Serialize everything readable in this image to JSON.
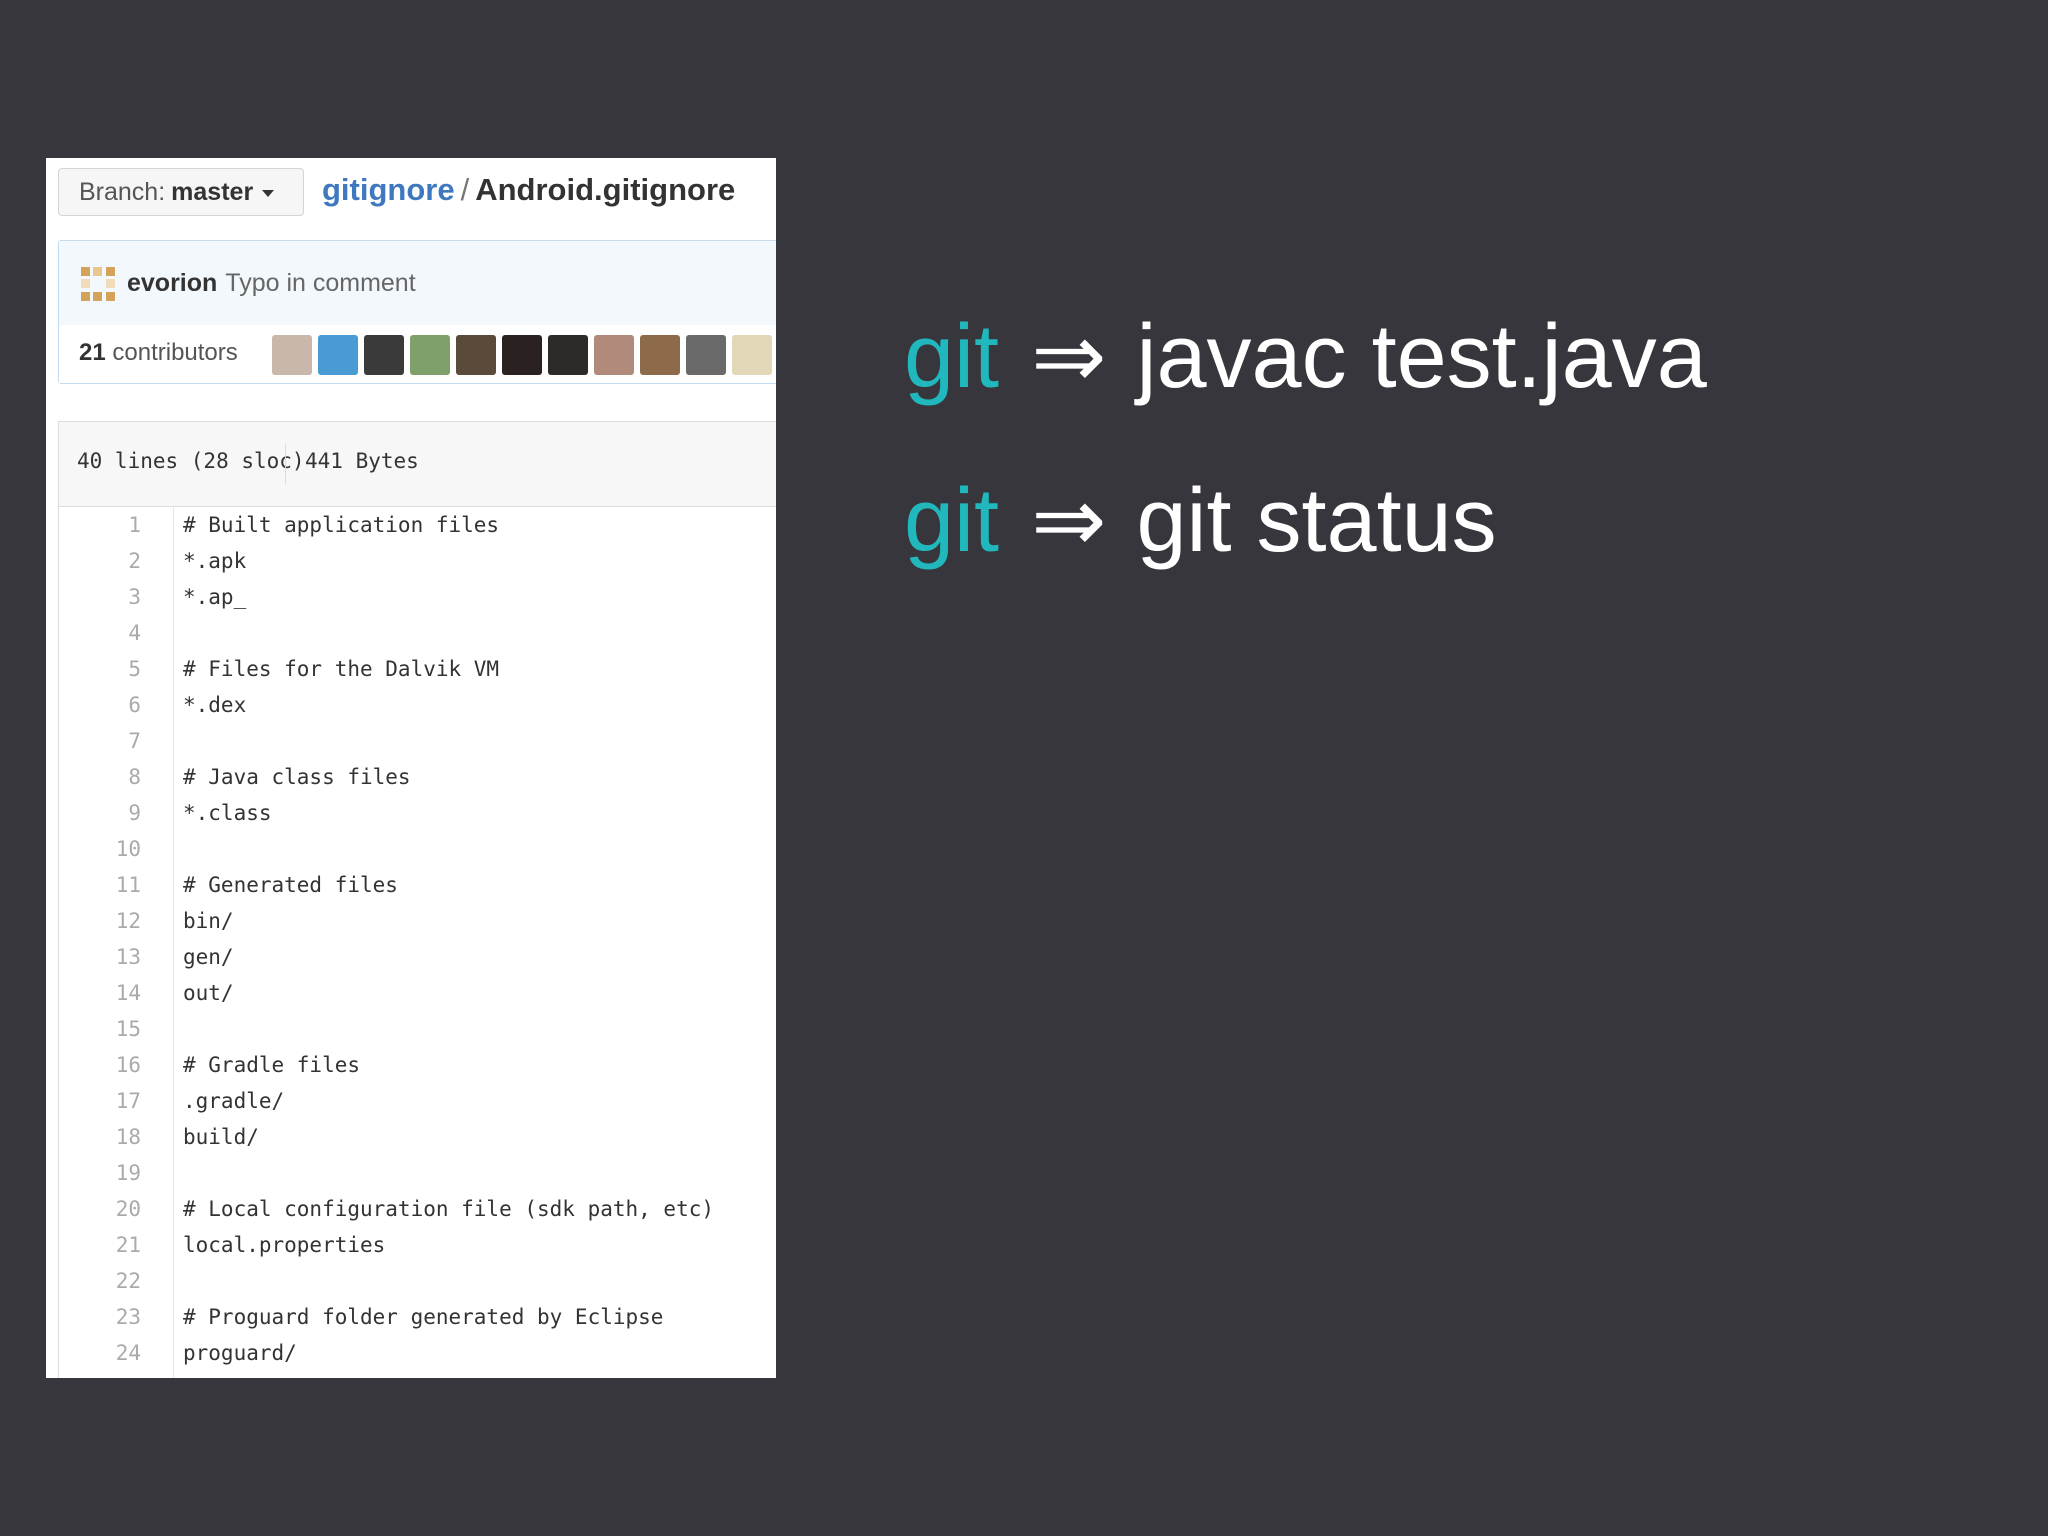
{
  "file_view": {
    "branch": {
      "prefix": "Branch:",
      "name": "master"
    },
    "breadcrumb": {
      "repo": "gitignore",
      "separator": "/",
      "file": "Android.gitignore"
    },
    "commit": {
      "author": "evorion",
      "message": "Typo in comment"
    },
    "contributors": {
      "count": "21",
      "label": "contributors"
    },
    "avatar_colors": [
      "#c9b7ab",
      "#4a9ad4",
      "#3a3a3a",
      "#7fa06a",
      "#5a4a3a",
      "#2a2220",
      "#2e2a28",
      "#b08a7a",
      "#8c6a4a",
      "#6a6a6a",
      "#e2d8b8"
    ],
    "file_info": {
      "lines": "40 lines (28 sloc)",
      "size": "441 Bytes"
    },
    "code_lines": [
      {
        "n": "1",
        "text": "# Built application files"
      },
      {
        "n": "2",
        "text": "*.apk"
      },
      {
        "n": "3",
        "text": "*.ap_"
      },
      {
        "n": "4",
        "text": ""
      },
      {
        "n": "5",
        "text": "# Files for the Dalvik VM"
      },
      {
        "n": "6",
        "text": "*.dex"
      },
      {
        "n": "7",
        "text": ""
      },
      {
        "n": "8",
        "text": "# Java class files"
      },
      {
        "n": "9",
        "text": "*.class"
      },
      {
        "n": "10",
        "text": ""
      },
      {
        "n": "11",
        "text": "# Generated files"
      },
      {
        "n": "12",
        "text": "bin/"
      },
      {
        "n": "13",
        "text": "gen/"
      },
      {
        "n": "14",
        "text": "out/"
      },
      {
        "n": "15",
        "text": ""
      },
      {
        "n": "16",
        "text": "# Gradle files"
      },
      {
        "n": "17",
        "text": ".gradle/"
      },
      {
        "n": "18",
        "text": "build/"
      },
      {
        "n": "19",
        "text": ""
      },
      {
        "n": "20",
        "text": "# Local configuration file (sdk path, etc)"
      },
      {
        "n": "21",
        "text": "local.properties"
      },
      {
        "n": "22",
        "text": ""
      },
      {
        "n": "23",
        "text": "# Proguard folder generated by Eclipse"
      },
      {
        "n": "24",
        "text": "proguard/"
      }
    ]
  },
  "slide": {
    "lines": [
      {
        "keyword": "git",
        "arrow": "⇒",
        "command": "javac test.java"
      },
      {
        "keyword": "git",
        "arrow": "⇒",
        "command": "git status"
      }
    ],
    "keyword_color": "#20b8bc"
  }
}
